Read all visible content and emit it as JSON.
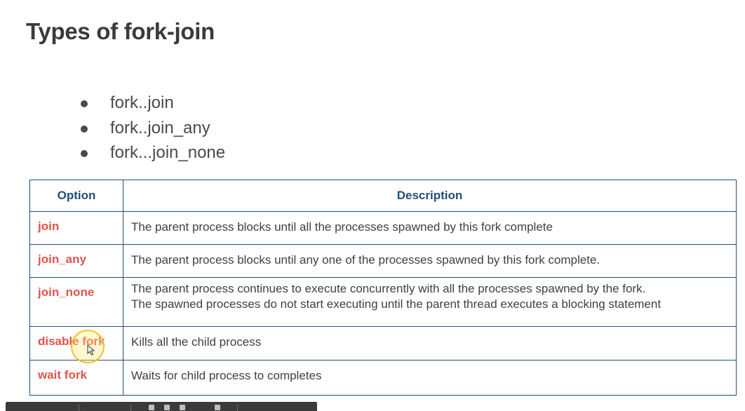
{
  "slide": {
    "title": "Types of fork-join",
    "bullets": [
      "fork..join",
      "fork..join_any",
      "fork...join_none"
    ]
  },
  "table": {
    "headers": {
      "option": "Option",
      "description": "Description"
    },
    "rows": [
      {
        "option": "join",
        "description": [
          "The parent process blocks until all the processes spawned by this fork complete"
        ]
      },
      {
        "option": "join_any",
        "description": [
          "The parent process blocks until any one of the processes spawned by this fork complete."
        ]
      },
      {
        "option": "join_none",
        "description": [
          "The parent process continues to execute concurrently with all the processes spawned by the fork.",
          "The spawned processes do not start executing until the parent thread executes a blocking statement"
        ]
      },
      {
        "option": "disable fork",
        "description": [
          "Kills all the child process"
        ]
      },
      {
        "option": "wait fork",
        "description": [
          "Waits for child process to completes"
        ]
      }
    ]
  },
  "colors": {
    "title": "#3a3a3a",
    "header_text": "#1f4e79",
    "option_text": "#e0524d",
    "table_border": "#1f4e79",
    "cursor_highlight": "#f2c12e"
  },
  "icons": [
    "mouse-pointer-icon"
  ]
}
